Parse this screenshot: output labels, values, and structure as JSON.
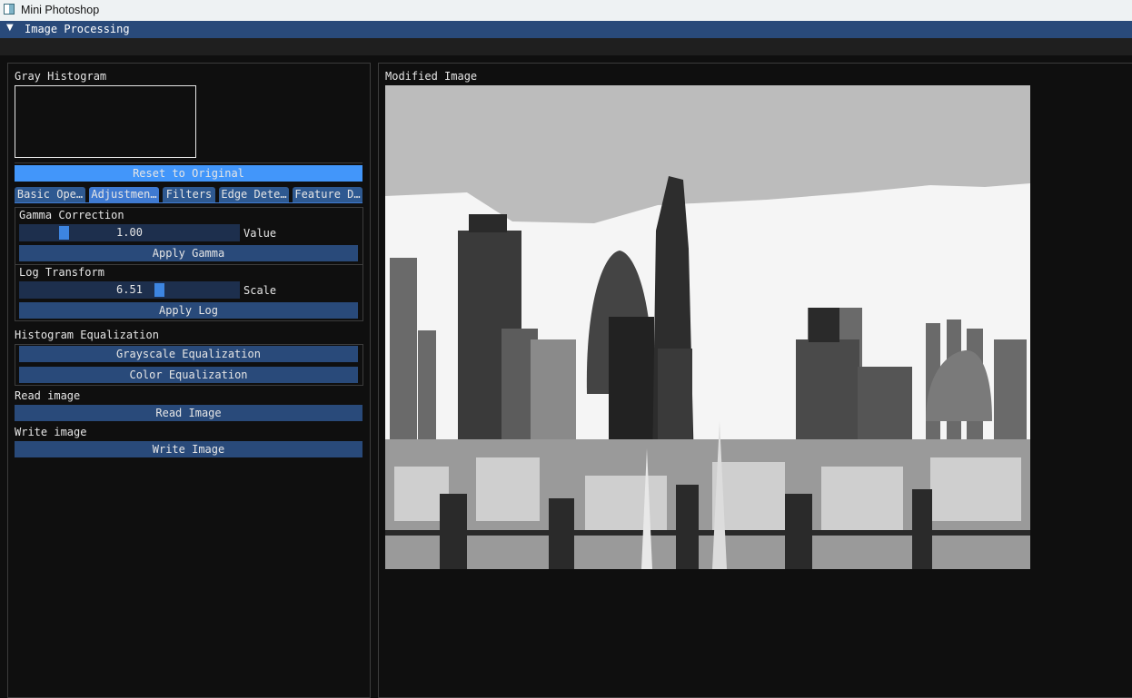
{
  "window": {
    "title": "Mini Photoshop"
  },
  "menu": {
    "header_label": "Image Processing",
    "header_arrow": "▼"
  },
  "left": {
    "histogram_label": "Gray Histogram",
    "reset_button": "Reset to Original",
    "tabs": [
      "Basic Ope…",
      "Adjustmen…",
      "Filters",
      "Edge Dete…",
      "Feature D…"
    ],
    "active_tab": 1,
    "gamma": {
      "section": "Gamma Correction",
      "value": "1.00",
      "value_label": "Value",
      "apply": "Apply Gamma",
      "slider_fraction": 0.2
    },
    "log": {
      "section": "Log Transform",
      "value": "6.51",
      "value_label": "Scale",
      "apply": "Apply Log",
      "slider_fraction": 0.65
    },
    "histeq": {
      "section": "Histogram Equalization",
      "gray_button": "Grayscale Equalization",
      "color_button": "Color Equalization"
    },
    "read": {
      "section": "Read image",
      "button": "Read Image"
    },
    "write": {
      "section": "Write image",
      "button": "Write Image"
    }
  },
  "right": {
    "image_label": "Modified Image"
  },
  "colors": {
    "accent": "#4296fa",
    "button": "#294a7a",
    "tab": "#2e5991",
    "tab_active": "#3f7ad1",
    "frame_bg": "#1d2f4d",
    "menu_bar": "#294a7a",
    "background": "#0f0f0f"
  }
}
